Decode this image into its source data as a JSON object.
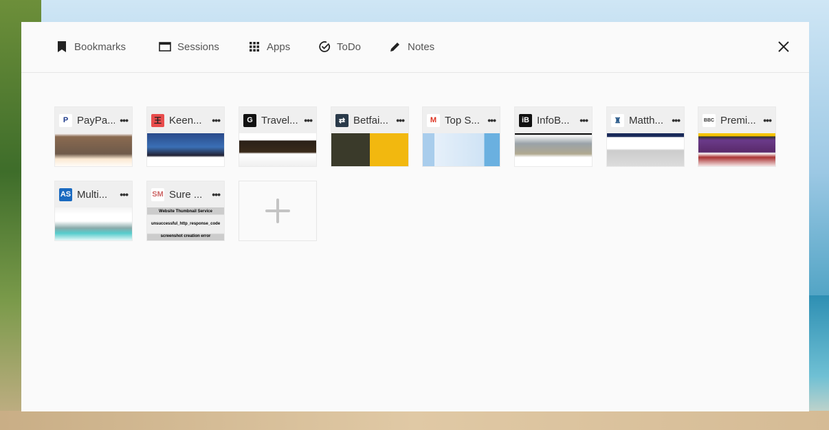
{
  "tabs": [
    {
      "label": "Bookmarks",
      "icon": "bookmark-icon"
    },
    {
      "label": "Sessions",
      "icon": "window-icon"
    },
    {
      "label": "Apps",
      "icon": "grid-icon"
    },
    {
      "label": "ToDo",
      "icon": "check-circle-icon"
    },
    {
      "label": "Notes",
      "icon": "pencil-icon"
    }
  ],
  "tiles": [
    {
      "title": "PayPa...",
      "fav": "P",
      "favColor": "#ffffff",
      "favText": "#1e3a8a",
      "thumb": "linear-gradient(180deg,#fff 0%,#8a6a50 10%,#6e5a4a 60%,#fbe9d2 75%,#fff 100%)"
    },
    {
      "title": "Keen...",
      "fav": "王",
      "favColor": "#e84c4c",
      "favText": "#222",
      "thumb": "linear-gradient(180deg,#2a4a8a 0%,#3a6fb5 40%,#223 65%,#fff 70%,#fff 100%)"
    },
    {
      "title": "Travel...",
      "fav": "G",
      "favColor": "#111",
      "favText": "#fff",
      "thumb": "linear-gradient(180deg,#fff 0%,#fff 20%,#2a2018 22%,#3a2a1a 55%,#fff 60%,#eee 100%)"
    },
    {
      "title": "Betfai...",
      "fav": "⇄",
      "favColor": "#2a3a4a",
      "favText": "#fff",
      "thumb": "linear-gradient(90deg,#3a3a2a 0%,#3a3a2a 50%,#f2b80f 50%,#f2b80f 100%)"
    },
    {
      "title": "Top S...",
      "fav": "M",
      "favColor": "#ffffff",
      "favText": "#d32",
      "thumb": "linear-gradient(90deg,#a9cdec 0%,#a9cdec 15%,#e6f0fa 15%,#cfe3f5 80%,#6ab0e0 80%)"
    },
    {
      "title": "InfoB...",
      "fav": "iB",
      "favColor": "#111",
      "favText": "#fff",
      "thumb": "linear-gradient(180deg,#111 0%,#111 4%,#fff 5%,#9aa2a8 30%,#b0a890 60%,#fff 70%)"
    },
    {
      "title": "Matth...",
      "fav": "♜",
      "favColor": "#ffffff",
      "favText": "#2a5a8a",
      "thumb": "linear-gradient(180deg,#1a2a5a 0%,#1a2a5a 10%,#fff 12%,#fff 45%,#ccc 50%,#ddd 100%)"
    },
    {
      "title": "Premi...",
      "fav": "BBC",
      "favColor": "#ffffff",
      "favText": "#333",
      "thumb": "linear-gradient(180deg,#f5c400 0%,#f5c400 8%,#333 10%,#6a3a8a 20%,#5a2a6a 55%,#fff 58%,#a33 70%,#fff 100%)"
    },
    {
      "title": "Multi...",
      "fav": "AS",
      "favColor": "#1a6ac0",
      "favText": "#fff",
      "thumb": "linear-gradient(180deg,#f4f4f4 0%,#fff 20%,#fff 40%,#8aa 60%,#5cc 75%,#fff 100%)"
    },
    {
      "title": "Sure ...",
      "fav": "SM",
      "favColor": "#ffffff",
      "favText": "#c66",
      "thumb": "linear-gradient(180deg,#ccc 0%,#ccc 20%,#eee 22%,#eee 75%,#ccc 78%)",
      "lines": [
        "Website Thumbnail Service",
        "unsuccessful_http_response_code",
        "screenshot creation error"
      ]
    }
  ]
}
